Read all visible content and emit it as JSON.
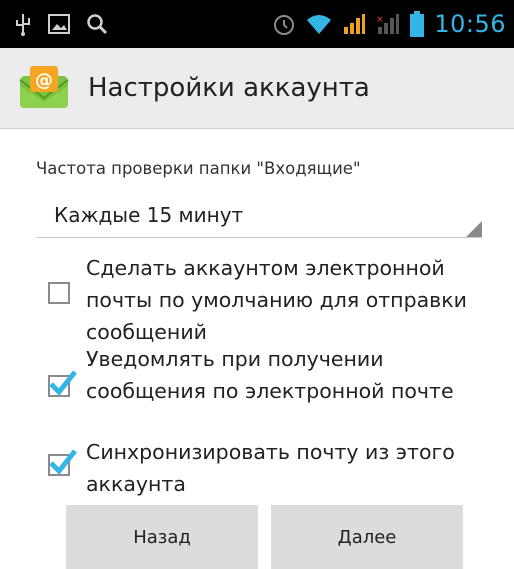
{
  "status_bar": {
    "time": "10:56",
    "icons": [
      "usb-icon",
      "gallery-icon",
      "search-icon",
      "alarm-icon",
      "wifi-icon",
      "signal-icon",
      "signal-secondary-icon",
      "battery-icon"
    ],
    "accent_color": "#33b5e5"
  },
  "action_bar": {
    "title": "Настройки аккаунта",
    "app_icon": "email-app-icon"
  },
  "settings": {
    "frequency_label": "Частота проверки папки \"Входящие\"",
    "frequency_value": "Каждые 15 минут",
    "options": [
      {
        "label": "Сделать аккаунтом электронной почты по умолчанию для отправки сообщений",
        "checked": false
      },
      {
        "label": "Уведомлять при получении сообщения по электронной почте",
        "checked": true
      },
      {
        "label": "Синхронизировать почту из этого аккаунта",
        "checked": true
      }
    ]
  },
  "buttons": {
    "back": "Назад",
    "next": "Далее"
  }
}
